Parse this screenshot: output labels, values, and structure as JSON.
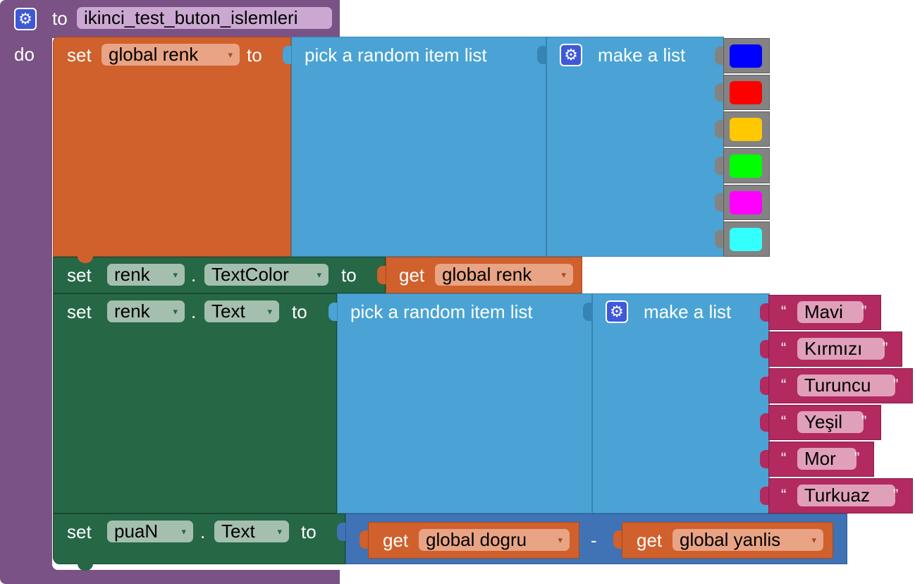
{
  "procedure": {
    "keyword_to": "to",
    "name": "ikinci_test_buton_islemleri",
    "keyword_do": "do",
    "gear_icon": "gear-icon"
  },
  "block1": {
    "set": "set",
    "variable": "global renk",
    "to": "to",
    "pick": "pick a random item  list",
    "make_list": "make a list",
    "colors": [
      "#0000ff",
      "#ff0000",
      "#ffc800",
      "#00ff00",
      "#ff00ff",
      "#33ffff"
    ]
  },
  "block2": {
    "set": "set",
    "component": "renk",
    "dot": ".",
    "property": "TextColor",
    "to": "to",
    "get": "get",
    "variable": "global renk"
  },
  "block3": {
    "set": "set",
    "component": "renk",
    "dot": ".",
    "property": "Text",
    "to": "to",
    "pick": "pick a random item  list",
    "make_list": "make a list",
    "quote_open": "“",
    "quote_close": "”",
    "items": [
      "Mavi",
      "Kırmızı",
      "Turuncu",
      "Yeşil",
      "Mor",
      "Turkuaz"
    ]
  },
  "block4": {
    "set": "set",
    "component": "puaN",
    "dot": ".",
    "property": "Text",
    "to": "to",
    "get1": "get",
    "var1": "global dogru",
    "minus": "-",
    "get2": "get",
    "var2": "global yanlis"
  },
  "dropdown_arrow": "▾"
}
